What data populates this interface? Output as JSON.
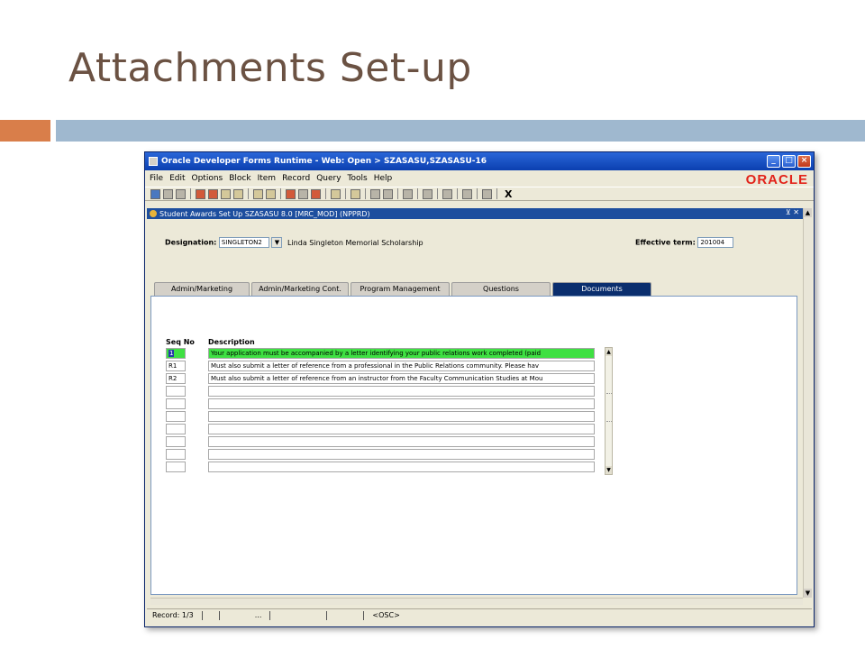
{
  "slide": {
    "title": "Attachments Set-up"
  },
  "window": {
    "title": "Oracle Developer Forms Runtime - Web:  Open > SZASASU,SZASASU-16",
    "controls": [
      "_",
      "□",
      "×"
    ]
  },
  "menu": {
    "items": [
      "File",
      "Edit",
      "Options",
      "Block",
      "Item",
      "Record",
      "Query",
      "Tools",
      "Help"
    ],
    "logo": "ORACLE"
  },
  "toolbar": {
    "exit_label": "X"
  },
  "form": {
    "title": "Student Awards Set Up  SZASASU  8.0  [MRC_MOD]  (NPPRD)",
    "window_controls": "⊻ ✕"
  },
  "header": {
    "designation_label": "Designation:",
    "designation_value": "SINGLETON2",
    "designation_desc": "Linda Singleton Memorial Scholarship",
    "term_label": "Effective term:",
    "term_value": "201004"
  },
  "tabs": [
    {
      "label": "Admin/Marketing",
      "active": false
    },
    {
      "label": "Admin/Marketing Cont.",
      "active": false
    },
    {
      "label": "Program Management",
      "active": false
    },
    {
      "label": "Questions",
      "active": false
    },
    {
      "label": "Documents",
      "active": true
    }
  ],
  "table": {
    "col_seq": "Seq No",
    "col_desc": "Description",
    "rows": [
      {
        "seq": "1",
        "desc": "Your application must be accompanied by a letter identifying your public relations work completed (paid"
      },
      {
        "seq": "R1",
        "desc": "Must also submit a letter of reference from a professional in the Public Relations community. Please hav"
      },
      {
        "seq": "R2",
        "desc": "Must also submit a letter of reference from an instructor from the Faculty Communication Studies at Mou"
      },
      {
        "seq": "",
        "desc": ""
      },
      {
        "seq": "",
        "desc": ""
      },
      {
        "seq": "",
        "desc": ""
      },
      {
        "seq": "",
        "desc": ""
      },
      {
        "seq": "",
        "desc": ""
      },
      {
        "seq": "",
        "desc": ""
      },
      {
        "seq": "",
        "desc": ""
      }
    ]
  },
  "status": {
    "record": "Record: 1/3",
    "ellipsis": "...",
    "mode": "<OSC>"
  },
  "colors": {
    "accent_orange": "#d97e4a",
    "accent_blue": "#9fb8cf",
    "current_row": "#3ee042",
    "oracle_red": "#e2231a"
  }
}
